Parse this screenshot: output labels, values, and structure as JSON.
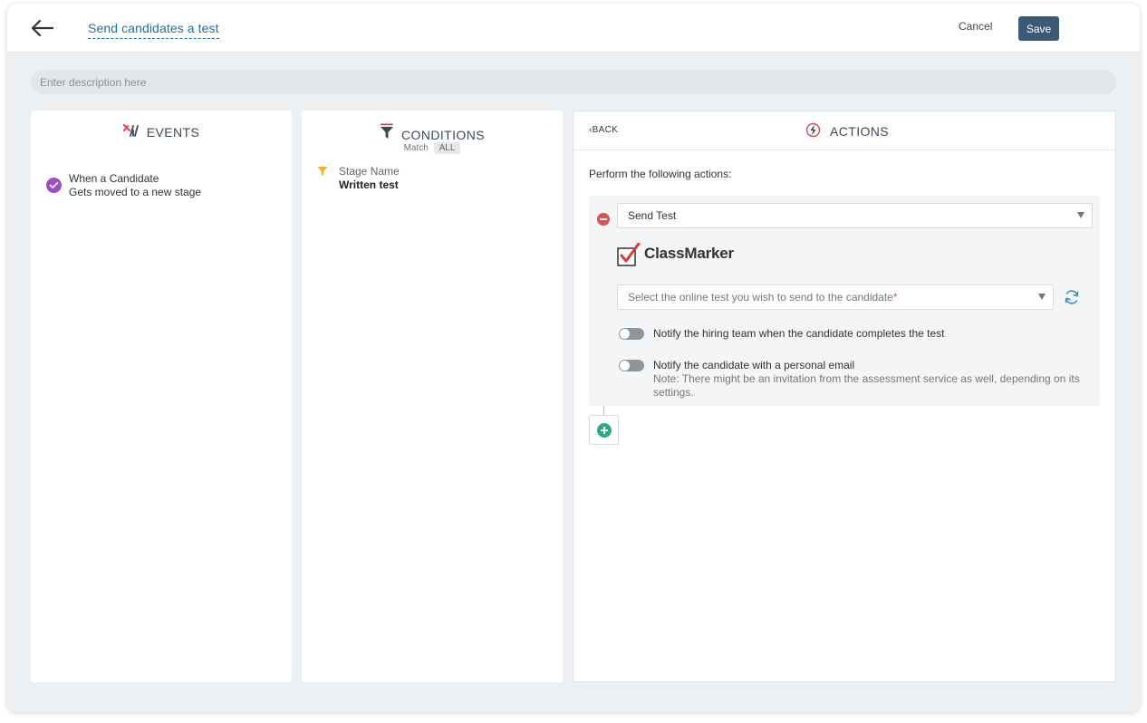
{
  "header": {
    "title": "Send candidates a test",
    "cancel_label": "Cancel",
    "save_label": "Save"
  },
  "description": {
    "placeholder": "Enter description here",
    "value": ""
  },
  "events": {
    "title": "EVENTS",
    "item_line1": "When a Candidate",
    "item_line2": "Gets moved to a new stage"
  },
  "conditions": {
    "title": "CONDITIONS",
    "match_label": "Match",
    "match_value": "ALL",
    "item_label": "Stage Name",
    "item_value": "Written test"
  },
  "actions": {
    "back_label": "BACK",
    "title": "ACTIONS",
    "perform_text": "Perform the following actions:",
    "action_select": "Send Test",
    "provider_name": "ClassMarker",
    "test_select_placeholder": "Select the online test you wish to send to the candidate",
    "test_select_required": "*",
    "toggle1_label": "Notify the hiring team when the candidate completes the test",
    "toggle2_label": "Notify the candidate with a personal email",
    "toggle2_note": "Note: There might be an invitation from the assessment service as well, depending on its settings.",
    "toggle1_on": false,
    "toggle2_on": false
  },
  "colors": {
    "accent": "#1f6f9a",
    "save_button": "#3c5a75",
    "event_check": "#9b4fc4",
    "remove": "#d9534f",
    "add": "#2daa7b",
    "condition_funnel": "#f0b323"
  },
  "icons": {
    "back": "arrow-left-icon",
    "events": "events-icon",
    "conditions": "funnel-icon",
    "actions": "lightning-icon",
    "refresh": "refresh-icon",
    "add": "plus-circle-icon",
    "remove": "minus-circle-icon"
  }
}
